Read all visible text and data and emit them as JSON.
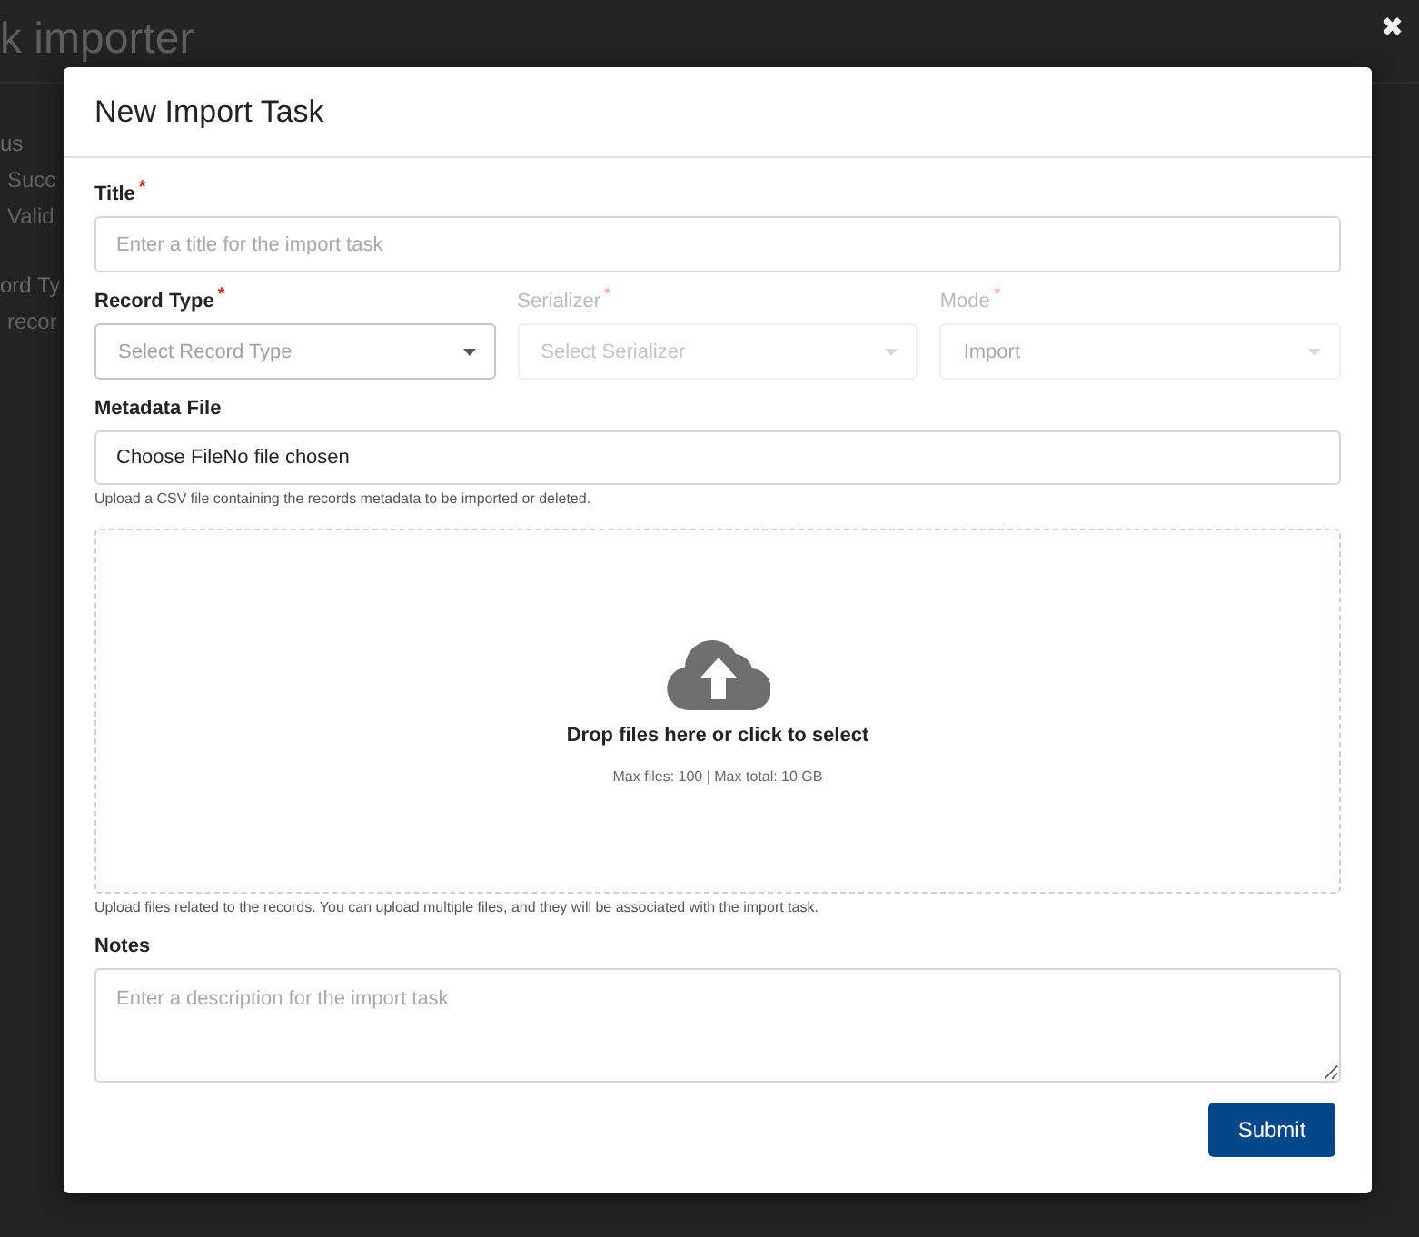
{
  "background_page": {
    "title": "k importer",
    "sections": [
      {
        "heading": "us",
        "items": [
          "Succ",
          "Valid"
        ]
      },
      {
        "heading": "ord Ty",
        "items": [
          "recor"
        ]
      }
    ],
    "close_symbol": "✖"
  },
  "modal": {
    "title": "New Import Task",
    "fields": [
      {
        "kind": "text",
        "label": "Title",
        "required_mark": "*",
        "disabled": false,
        "placeholder": "Enter a title for the import task"
      },
      {
        "kind": "select_row",
        "items": [
          {
            "label": "Record Type",
            "required_mark": "*",
            "disabled": false,
            "placeholder": "Select Record Type"
          },
          {
            "label": "Serializer",
            "required_mark": "*",
            "disabled": true,
            "placeholder": "Select Serializer"
          },
          {
            "label": "Mode",
            "required_mark": "*",
            "disabled": true,
            "value": "Import"
          }
        ]
      },
      {
        "kind": "file",
        "label": "Metadata File",
        "button": "Choose File",
        "status": "No file chosen",
        "help": "Upload a CSV file containing the records metadata to be imported or deleted."
      },
      {
        "kind": "dropzone",
        "prompt": "Drop files here or click to select",
        "limits": "Max files: 100 | Max total: 10 GB",
        "help": "Upload files related to the records. You can upload multiple files, and they will be associated with the import task."
      },
      {
        "kind": "textarea",
        "label": "Notes",
        "placeholder": "Enter a description for the import task"
      }
    ],
    "submit": "Submit"
  }
}
